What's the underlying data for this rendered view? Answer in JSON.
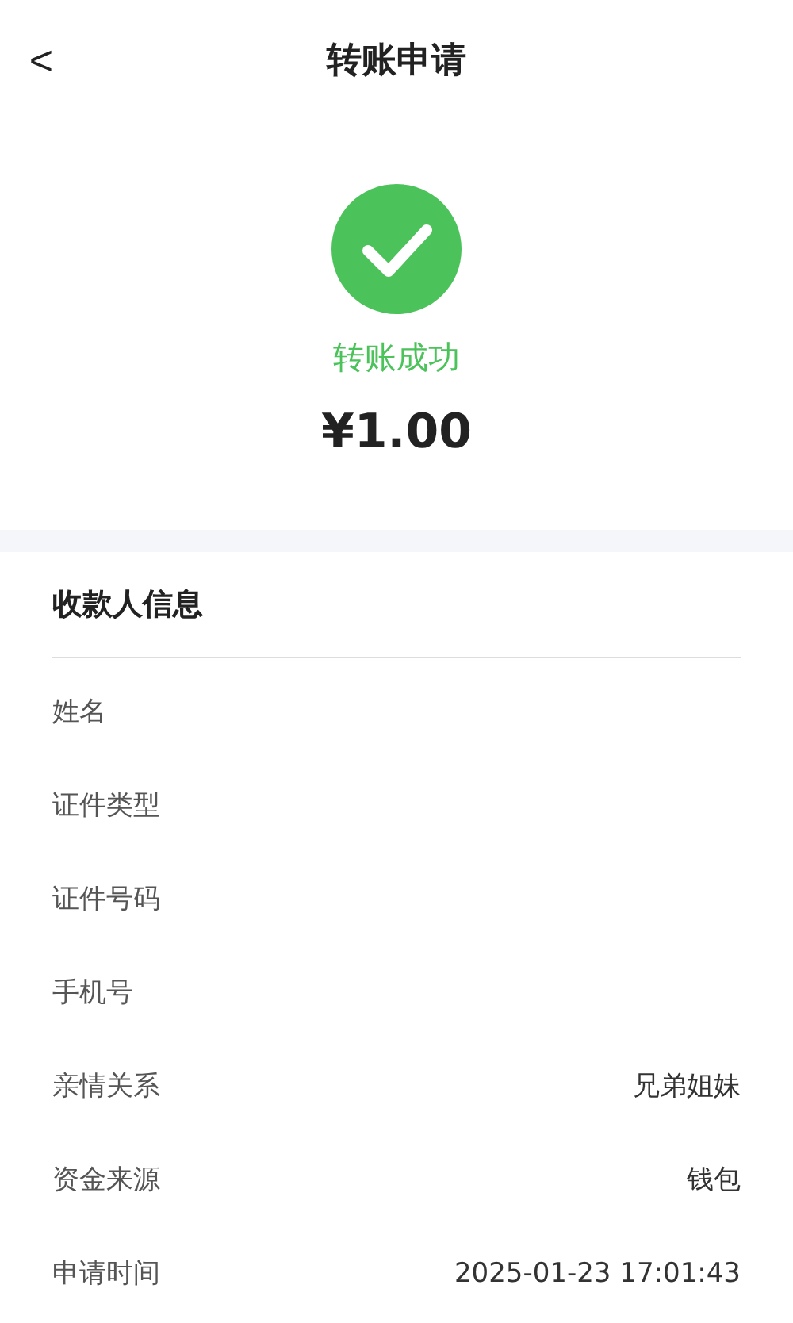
{
  "header": {
    "back": "<",
    "title": "转账申请"
  },
  "result": {
    "status": "转账成功",
    "amount": "¥1.00"
  },
  "payee": {
    "title": "收款人信息",
    "rows": [
      {
        "label": "姓名"
      },
      {
        "label": "证件类型"
      },
      {
        "label": "证件号码"
      },
      {
        "label": "手机号"
      },
      {
        "label": "亲情关系",
        "value": "兄弟姐妹"
      },
      {
        "label": "资金来源",
        "value": "钱包"
      },
      {
        "label": "申请时间",
        "value": "2025-01-23 17:01:43"
      }
    ]
  }
}
